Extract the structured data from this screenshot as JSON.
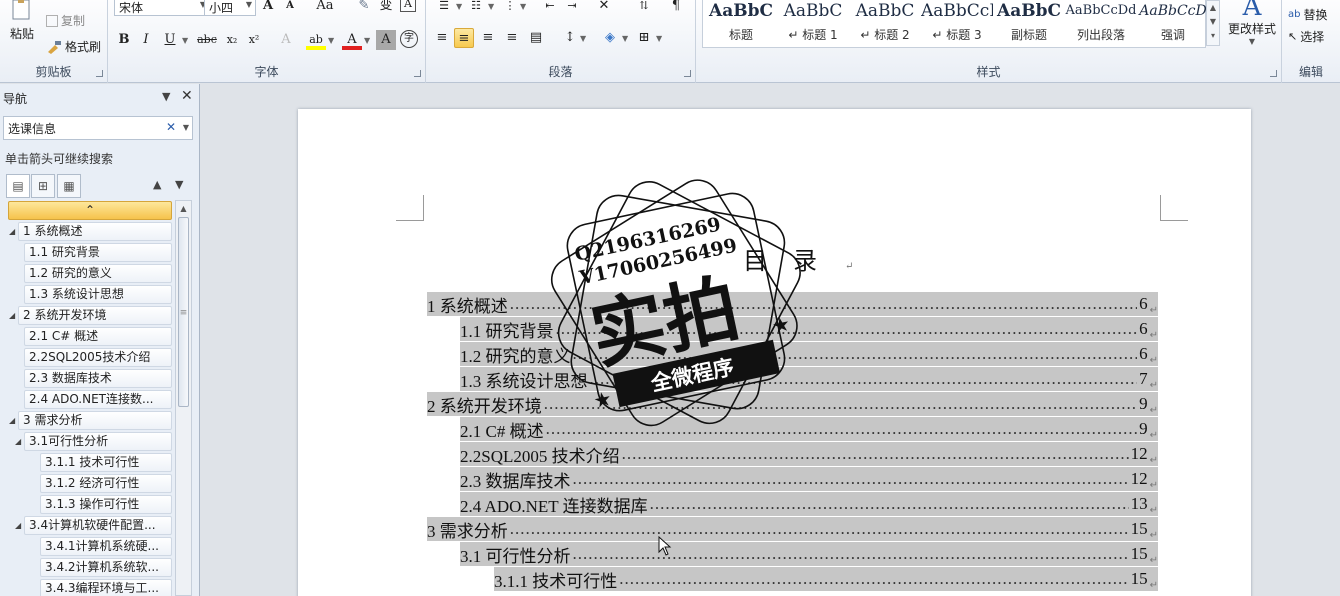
{
  "ribbon": {
    "clipboard": {
      "group_label": "剪贴板",
      "paste_label": "粘贴",
      "copy_label": "复制",
      "format_painter_label": "格式刷"
    },
    "font": {
      "group_label": "字体",
      "font_name": "宋体",
      "font_size": "小四",
      "aa_label": "Aa",
      "grow_label": "A",
      "shrink_label": "A",
      "wen_label": "变",
      "bold": "B",
      "italic": "I",
      "underline": "U",
      "strike": "abc",
      "subscript": "x₂",
      "superscript": "x²",
      "font_color_glyph": "A",
      "shade_glyph": "A",
      "enclose_glyph": "字"
    },
    "paragraph": {
      "group_label": "段落"
    },
    "styles": {
      "group_label": "样式",
      "items": [
        {
          "sample": "AaBbC",
          "name": "标题"
        },
        {
          "sample": "AaBbC",
          "name": "↵ 标题 1"
        },
        {
          "sample": "AaBbC",
          "name": "↵ 标题 2"
        },
        {
          "sample": "AaBbCcI",
          "name": "↵ 标题 3"
        },
        {
          "sample": "AaBbC",
          "name": "副标题"
        },
        {
          "sample": "AaBbCcDd",
          "name": "列出段落"
        },
        {
          "sample": "AaBbCcD",
          "name": "强调"
        }
      ],
      "change_styles_label": "更改样式"
    },
    "editing": {
      "group_label": "编辑",
      "replace_label": "替换",
      "select_label": "选择"
    }
  },
  "navigation": {
    "title": "导航",
    "search_value": "选课信息",
    "hint": "单击箭头可继续搜索",
    "tree": [
      {
        "label": "1 系统概述",
        "level": 0
      },
      {
        "label": "1.1 研究背景",
        "level": 1
      },
      {
        "label": "1.2 研究的意义",
        "level": 1
      },
      {
        "label": "1.3 系统设计思想",
        "level": 1
      },
      {
        "label": "2 系统开发环境",
        "level": 0
      },
      {
        "label": "2.1 C# 概述",
        "level": 1
      },
      {
        "label": "2.2SQL2005技术介绍",
        "level": 1
      },
      {
        "label": "2.3 数据库技术",
        "level": 1
      },
      {
        "label": "2.4  ADO.NET连接数...",
        "level": 1
      },
      {
        "label": "3 需求分析",
        "level": 0
      },
      {
        "label": "3.1可行性分析",
        "level": 1
      },
      {
        "label": "3.1.1 技术可行性",
        "level": 2
      },
      {
        "label": "3.1.2 经济可行性",
        "level": 2
      },
      {
        "label": "3.1.3 操作可行性",
        "level": 2
      },
      {
        "label": "3.4计算机软硬件配置...",
        "level": 1
      },
      {
        "label": "3.4.1计算机系统硬...",
        "level": 2
      },
      {
        "label": "3.4.2计算机系统软...",
        "level": 2
      },
      {
        "label": "3.4.3编程环境与工...",
        "level": 2
      }
    ]
  },
  "document": {
    "toc_title": "目录",
    "entries": [
      {
        "text": "1  系统概述",
        "page": "6",
        "level": 0
      },
      {
        "text": "1.1  研究背景",
        "page": "6",
        "level": 1
      },
      {
        "text": "1.2  研究的意义",
        "page": "6",
        "level": 1
      },
      {
        "text": "1.3  系统设计思想",
        "page": "7",
        "level": 1
      },
      {
        "text": "2  系统开发环境",
        "page": "9",
        "level": 0
      },
      {
        "text": "2.1 C#  概述",
        "page": "9",
        "level": 1
      },
      {
        "text": "2.2SQL2005 技术介绍",
        "page": "12",
        "level": 1
      },
      {
        "text": "2.3  数据库技术",
        "page": "12",
        "level": 1
      },
      {
        "text": "2.4    ADO.NET 连接数据库",
        "page": "13",
        "level": 1
      },
      {
        "text": "3  需求分析",
        "page": "15",
        "level": 0
      },
      {
        "text": "3.1 可行性分析",
        "page": "15",
        "level": 1
      },
      {
        "text": "3.1.1  技术可行性",
        "page": "15",
        "level": 2
      }
    ]
  },
  "watermark": {
    "line1": "Q2196316269",
    "line2": "V17060256499",
    "main_text": "实拍",
    "banner_text": "全微程序"
  },
  "colors": {
    "highlight": "#c6c6c6",
    "nav_selected": "#f6c34c",
    "ribbon_bg": "#e9eef5"
  }
}
